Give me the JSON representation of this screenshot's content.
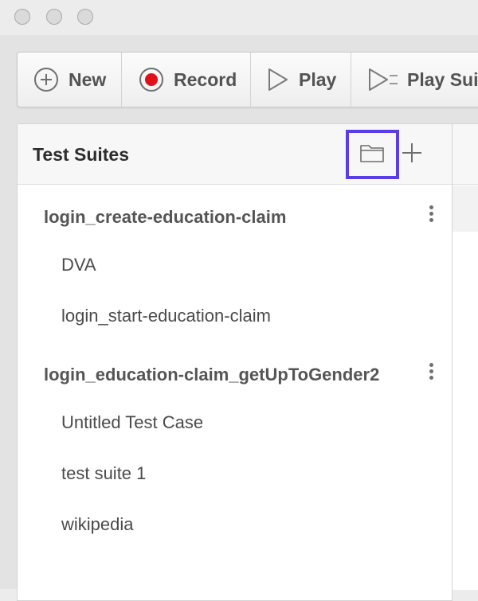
{
  "window": {
    "traffic_lights": [
      "close-icon",
      "minimize-icon",
      "zoom-icon"
    ]
  },
  "toolbar": {
    "new_label": "New",
    "record_label": "Record",
    "play_label": "Play",
    "play_suite_label": "Play Suit",
    "record_color": "#e0101a"
  },
  "panel": {
    "title": "Test Suites",
    "focus_color": "#5a3de6",
    "suites": [
      {
        "name": "login_create-education-claim",
        "cases": [
          "DVA",
          "login_start-education-claim"
        ]
      },
      {
        "name": "login_education-claim_getUpToGender2",
        "cases": [
          "Untitled Test Case",
          "test suite 1",
          "wikipedia"
        ]
      }
    ]
  }
}
